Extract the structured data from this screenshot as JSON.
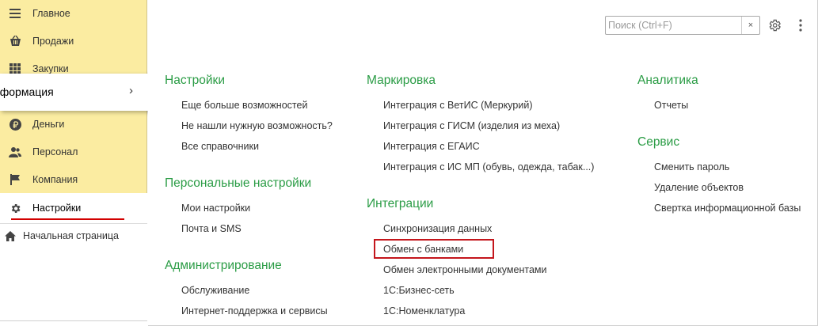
{
  "sidebar": {
    "items": [
      {
        "label": "Главное",
        "icon": "menu-lines-icon"
      },
      {
        "label": "Продажи",
        "icon": "cart-icon"
      },
      {
        "label": "Закупки",
        "icon": "grid-icon"
      },
      {
        "label": "Деньги",
        "icon": "ruble-icon"
      },
      {
        "label": "Персонал",
        "icon": "people-icon"
      },
      {
        "label": "Компания",
        "icon": "flag-icon"
      },
      {
        "label": "Настройки",
        "icon": "gear-icon"
      }
    ],
    "home_label": "Начальная страница"
  },
  "popup": {
    "label": "нформация",
    "chevron": "›"
  },
  "search": {
    "placeholder": "Поиск (Ctrl+F)",
    "value": "",
    "clear": "×"
  },
  "sections": {
    "nastroiki": {
      "title": "Настройки",
      "links": [
        "Еще больше возможностей",
        "Не нашли нужную возможность?",
        "Все справочники"
      ]
    },
    "personal": {
      "title": "Персональные настройки",
      "links": [
        "Мои настройки",
        "Почта и SMS"
      ]
    },
    "admin": {
      "title": "Администрирование",
      "links": [
        "Обслуживание",
        "Интернет-поддержка и сервисы"
      ]
    },
    "markirovka": {
      "title": "Маркировка",
      "links": [
        "Интеграция с ВетИС (Меркурий)",
        "Интеграция с ГИСМ (изделия из меха)",
        "Интеграция с ЕГАИС",
        "Интеграция с ИС МП (обувь, одежда, табак...)"
      ]
    },
    "integracii": {
      "title": "Интеграции",
      "links": [
        "Синхронизация данных",
        "Обмен с банками",
        "Обмен электронными документами",
        "1С:Бизнес-сеть",
        "1С:Номенклатура"
      ]
    },
    "analitika": {
      "title": "Аналитика",
      "links": [
        "Отчеты"
      ]
    },
    "servis": {
      "title": "Сервис",
      "links": [
        "Сменить пароль",
        "Удаление объектов",
        "Свертка информационной базы"
      ]
    }
  },
  "colors": {
    "sidebar_bg": "#fbeca1",
    "section_title": "#2a9c45",
    "highlight": "#c4161c",
    "active_underline": "#d20000"
  }
}
